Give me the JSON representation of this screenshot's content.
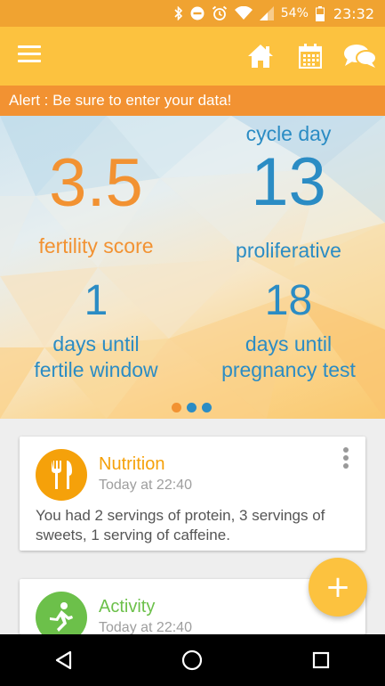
{
  "status_bar": {
    "battery_percent": "54%",
    "time": "23:32",
    "icons": [
      "bluetooth-icon",
      "do-not-disturb-icon",
      "alarm-icon",
      "wifi-icon",
      "signal-icon",
      "battery-icon"
    ]
  },
  "app_bar": {
    "icons": [
      "menu-icon",
      "home-icon",
      "calendar-icon",
      "chat-icon"
    ],
    "color": "#fcc23f"
  },
  "alert": {
    "text": "Alert : Be sure to enter your data!",
    "color": "#f29232"
  },
  "hero": {
    "fertility_score": {
      "value": "3.5",
      "label": "fertility score"
    },
    "cycle_day": {
      "heading": "cycle day",
      "value": "13",
      "phase": "proliferative"
    },
    "fertile_window": {
      "value": "1",
      "label_line1": "days until",
      "label_line2": "fertile window"
    },
    "pregnancy_test": {
      "value": "18",
      "label_line1": "days until",
      "label_line2": "pregnancy test"
    },
    "pager_dots": [
      {
        "color": "#f29232",
        "active": true
      },
      {
        "color": "#2b8cc4",
        "active": false
      },
      {
        "color": "#2b8cc4",
        "active": false
      }
    ]
  },
  "cards": [
    {
      "title": "Nutrition",
      "time": "Today at 22:40",
      "body": "You had 2 servings of protein, 3 servings of sweets, 1 serving of caffeine.",
      "icon": "fork-knife-icon",
      "color": "#f5a10a"
    },
    {
      "title": "Activity",
      "time": "Today at 22:40",
      "icon": "runner-icon",
      "color": "#6cc04a"
    }
  ],
  "fab": {
    "label": "+"
  },
  "nav_bar": {
    "icons": [
      "back-icon",
      "home-nav-icon",
      "recents-icon"
    ]
  }
}
